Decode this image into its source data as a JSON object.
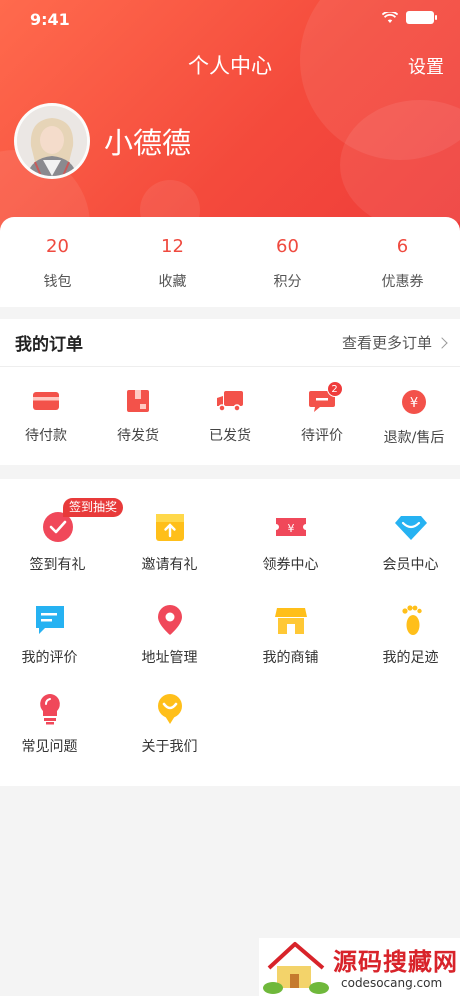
{
  "status_bar": {
    "time": "9:41"
  },
  "header": {
    "title": "个人中心",
    "settings_label": "设置"
  },
  "profile": {
    "username": "小德德"
  },
  "stats": [
    {
      "value": "20",
      "label": "钱包"
    },
    {
      "value": "12",
      "label": "收藏"
    },
    {
      "value": "60",
      "label": "积分"
    },
    {
      "value": "6",
      "label": "优惠券"
    }
  ],
  "orders": {
    "title": "我的订单",
    "more_label": "查看更多订单",
    "items": [
      {
        "label": "待付款",
        "icon": "card-icon"
      },
      {
        "label": "待发货",
        "icon": "package-icon"
      },
      {
        "label": "已发货",
        "icon": "truck-icon"
      },
      {
        "label": "待评价",
        "icon": "comment-icon",
        "badge": "2"
      },
      {
        "label": "退款/售后",
        "icon": "yuan-icon"
      }
    ]
  },
  "services": {
    "lottery_tag": "签到抽奖",
    "items": [
      {
        "label": "签到有礼",
        "icon": "check-circle-icon"
      },
      {
        "label": "邀请有礼",
        "icon": "gift-icon"
      },
      {
        "label": "领券中心",
        "icon": "coupon-icon"
      },
      {
        "label": "会员中心",
        "icon": "diamond-icon"
      },
      {
        "label": "我的评价",
        "icon": "review-icon"
      },
      {
        "label": "地址管理",
        "icon": "location-pin-icon"
      },
      {
        "label": "我的商铺",
        "icon": "shop-icon"
      },
      {
        "label": "我的足迹",
        "icon": "footprint-icon"
      },
      {
        "label": "常见问题",
        "icon": "bulb-icon"
      },
      {
        "label": "关于我们",
        "icon": "about-icon"
      }
    ]
  },
  "watermark": {
    "text": "源码搜藏网",
    "url": "codesocang.com"
  },
  "colors": {
    "brand_red": "#ef4a3f",
    "gradient_start": "#ff6a4d",
    "gradient_end": "#ee3b3a"
  }
}
